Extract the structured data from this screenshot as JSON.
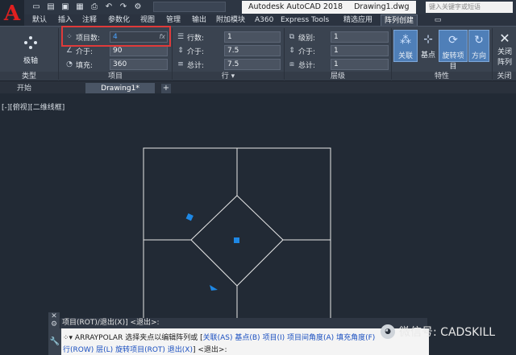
{
  "title": {
    "app": "Autodesk AutoCAD 2018",
    "document": "Drawing1.dwg",
    "help_search_placeholder": "键入关键字或短语"
  },
  "ribbon_tabs": [
    {
      "label": "默认"
    },
    {
      "label": "插入"
    },
    {
      "label": "注释"
    },
    {
      "label": "参数化"
    },
    {
      "label": "视图"
    },
    {
      "label": "管理"
    },
    {
      "label": "输出"
    },
    {
      "label": "附加模块"
    },
    {
      "label": "A360"
    },
    {
      "label": "Express Tools"
    },
    {
      "label": "精选应用"
    },
    {
      "label": "阵列创建"
    }
  ],
  "ribbon": {
    "type_panel": {
      "button": "极轴",
      "title": "类型"
    },
    "items_panel": {
      "title": "项目",
      "count_label": "项目数:",
      "count_value": "4",
      "between_label": "介于:",
      "between_value": "90",
      "fill_label": "填充:",
      "fill_value": "360"
    },
    "rows_panel": {
      "title": "行 ▾",
      "rows_label": "行数:",
      "rows_value": "1",
      "between_label": "介于:",
      "between_value": "7.5",
      "total_label": "总计:",
      "total_value": "7.5"
    },
    "levels_panel": {
      "title": "层级",
      "levels_label": "级别:",
      "levels_value": "1",
      "between_label": "介于:",
      "between_value": "1",
      "total_label": "总计:",
      "total_value": "1"
    },
    "properties_panel": {
      "title": "特性",
      "associative": "关联",
      "base_point": "基点",
      "rotate_items": "旋转项目",
      "direction": "方向"
    },
    "close_panel": {
      "title": "关闭",
      "close_line1": "关闭",
      "close_line2": "阵列"
    }
  },
  "file_tabs": [
    {
      "label": "开始"
    },
    {
      "label": "Drawing1*"
    }
  ],
  "viewport_label": "[-][俯视][二维线框]",
  "command": {
    "history": "项目(ROT)/退出(X)] <退出>:",
    "prompt_cmd": "ARRAYPOLAR",
    "prompt_text": "选择夹点以编辑阵列或",
    "options_line1": [
      "关联(AS)",
      "基点(B)",
      "项目(I)",
      "项目间角度(A)",
      "填充角度(F)"
    ],
    "options_line2": [
      "行(ROW)",
      "层(L)",
      "旋转项目(ROT)",
      "退出(X)"
    ],
    "tail": "<退出>:"
  },
  "watermark": "微信号: CADSKILL",
  "colors": {
    "accent_blue": "#1e88e5",
    "highlight_red": "#e03a3a",
    "canvas_bg": "#222a35"
  }
}
